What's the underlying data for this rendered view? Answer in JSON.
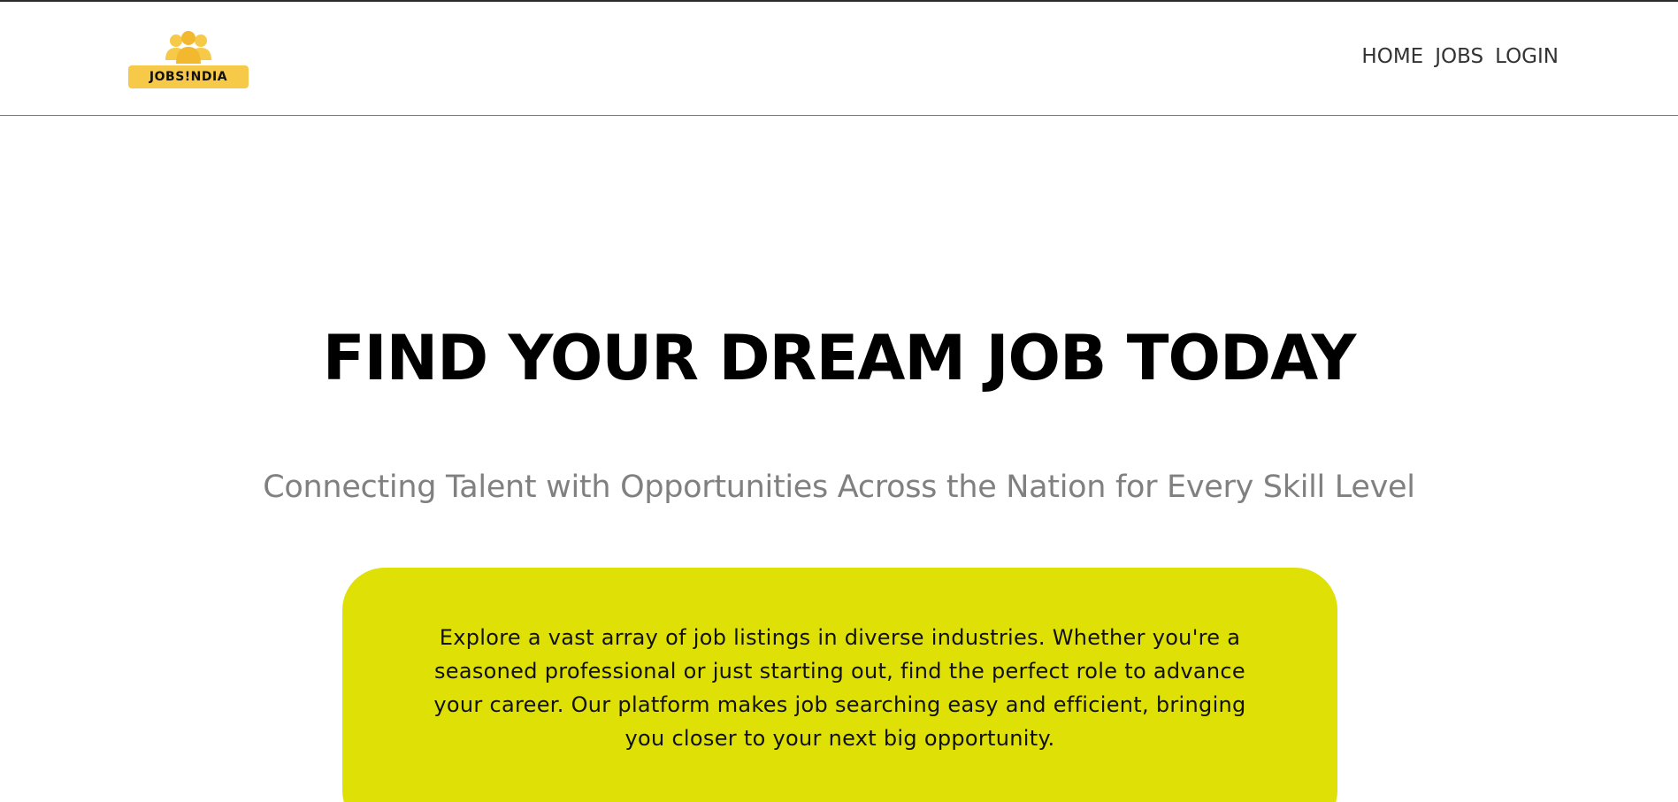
{
  "header": {
    "logo_text": "JOBS!NDIA",
    "logo_icon": "people-group-icon",
    "nav": {
      "home": "HOME",
      "jobs": "JOBS",
      "login": "LOGIN"
    }
  },
  "hero": {
    "title": "FIND YOUR DREAM JOB TODAY",
    "subtitle": "Connecting Talent with Opportunities Across the Nation for Every Skill Level",
    "card_text": "Explore a vast array of job listings in diverse industries. Whether you're a seasoned professional or just starting out, find the perfect role to advance your career. Our platform makes job searching easy and efficient, bringing you closer to your next big opportunity."
  },
  "colors": {
    "brand_yellow": "#f7c948",
    "card_yellow": "#dfe005",
    "subtitle_gray": "#808080"
  }
}
